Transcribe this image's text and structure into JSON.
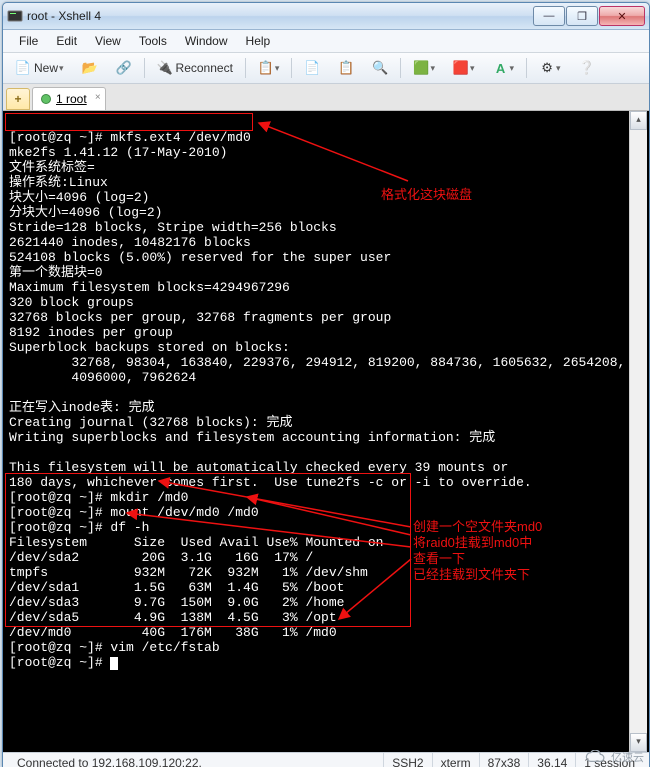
{
  "window": {
    "title": "root - Xshell 4"
  },
  "winbtns": {
    "min": "—",
    "max": "❐",
    "close": "✕"
  },
  "menu": {
    "file": "File",
    "edit": "Edit",
    "view": "View",
    "tools": "Tools",
    "window": "Window",
    "help": "Help"
  },
  "toolbar": {
    "new": "New",
    "reconnect": "Reconnect",
    "icons": {
      "new": "📄",
      "open": "📂",
      "link": "🔗",
      "disconnect": "🔌",
      "props": "📋",
      "copy": "📄",
      "paste": "📋",
      "find": "🔍",
      "color1": "🟩",
      "color2": "🟥",
      "font": "A",
      "cog": "⚙",
      "help": "❔"
    }
  },
  "tab": {
    "label": "1 root"
  },
  "terminal": {
    "line1": "[root@zq ~]# mkfs.ext4 /dev/md0",
    "line2": "mke2fs 1.41.12 (17-May-2010)",
    "line3": "文件系统标签=",
    "line4": "操作系统:Linux",
    "line5": "块大小=4096 (log=2)",
    "line6": "分块大小=4096 (log=2)",
    "line7": "Stride=128 blocks, Stripe width=256 blocks",
    "line8": "2621440 inodes, 10482176 blocks",
    "line9": "524108 blocks (5.00%) reserved for the super user",
    "line10": "第一个数据块=0",
    "line11": "Maximum filesystem blocks=4294967296",
    "line12": "320 block groups",
    "line13": "32768 blocks per group, 32768 fragments per group",
    "line14": "8192 inodes per group",
    "line15": "Superblock backups stored on blocks:",
    "line16": "        32768, 98304, 163840, 229376, 294912, 819200, 884736, 1605632, 2654208,",
    "line17": "        4096000, 7962624",
    "line18": "",
    "line19": "正在写入inode表: 完成",
    "line20": "Creating journal (32768 blocks): 完成",
    "line21": "Writing superblocks and filesystem accounting information: 完成",
    "line22": "",
    "line23": "This filesystem will be automatically checked every 39 mounts or",
    "line24": "180 days, whichever comes first.  Use tune2fs -c or -i to override.",
    "line25": "[root@zq ~]# mkdir /md0",
    "line26": "[root@zq ~]# mount /dev/md0 /md0",
    "line27": "[root@zq ~]# df -h",
    "line28": "Filesystem      Size  Used Avail Use% Mounted on",
    "line29": "/dev/sda2        20G  3.1G   16G  17% /",
    "line30": "tmpfs           932M   72K  932M   1% /dev/shm",
    "line31": "/dev/sda1       1.5G   63M  1.4G   5% /boot",
    "line32": "/dev/sda3       9.7G  150M  9.0G   2% /home",
    "line33": "/dev/sda5       4.9G  138M  4.5G   3% /opt",
    "line34": "/dev/md0         40G  176M   38G   1% /md0",
    "line35": "[root@zq ~]# vim /etc/fstab",
    "line36": "[root@zq ~]# "
  },
  "annotations": {
    "a1": "格式化这块磁盘",
    "a2": "创建一个空文件夹md0\n将raid0挂载到md0中\n查看一下\n已经挂载到文件夹下"
  },
  "status": {
    "conn": "Connected to 192.168.109.120:22.",
    "proto": "SSH2",
    "term": "xterm",
    "size": "87x38",
    "pos": "36,14",
    "sess": "1 session"
  },
  "watermark": "亿速云"
}
